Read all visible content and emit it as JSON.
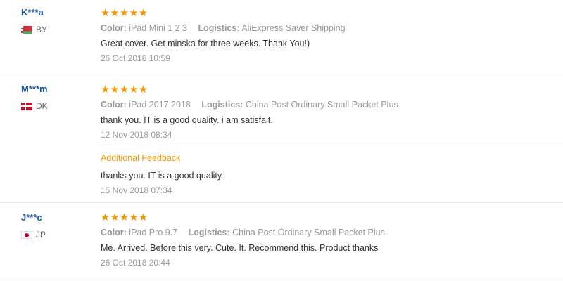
{
  "reviews": [
    {
      "user": "K***a",
      "country_code": "BY",
      "stars": 5,
      "color_label": "Color:",
      "color_value": "iPad Mini 1 2 3",
      "logistics_label": "Logistics:",
      "logistics_value": "AliExpress Saver Shipping",
      "text": "Great cover. Get minska for three weeks. Thank You!)",
      "date": "26 Oct 2018 10:59"
    },
    {
      "user": "M***m",
      "country_code": "DK",
      "stars": 5,
      "color_label": "Color:",
      "color_value": "iPad 2017 2018",
      "logistics_label": "Logistics:",
      "logistics_value": "China Post Ordinary Small Packet Plus",
      "text": "thank you. IT is a good quality. i am satisfait.",
      "date": "12 Nov 2018 08:34",
      "additional": {
        "title": "Additional Feedback",
        "text": "thanks you. IT is a good quality.",
        "date": "15 Nov 2018 07:34"
      }
    },
    {
      "user": "J***c",
      "country_code": "JP",
      "stars": 5,
      "color_label": "Color:",
      "color_value": "iPad Pro 9.7",
      "logistics_label": "Logistics:",
      "logistics_value": "China Post Ordinary Small Packet Plus",
      "text": "Me. Arrived. Before this very. Cute. It. Recommend this. Product thanks",
      "date": "26 Oct 2018 20:44"
    }
  ],
  "colors": {
    "user": "#1a5ba8",
    "star": "#f39700",
    "additional_title": "#f39700",
    "meta": "#999999"
  }
}
